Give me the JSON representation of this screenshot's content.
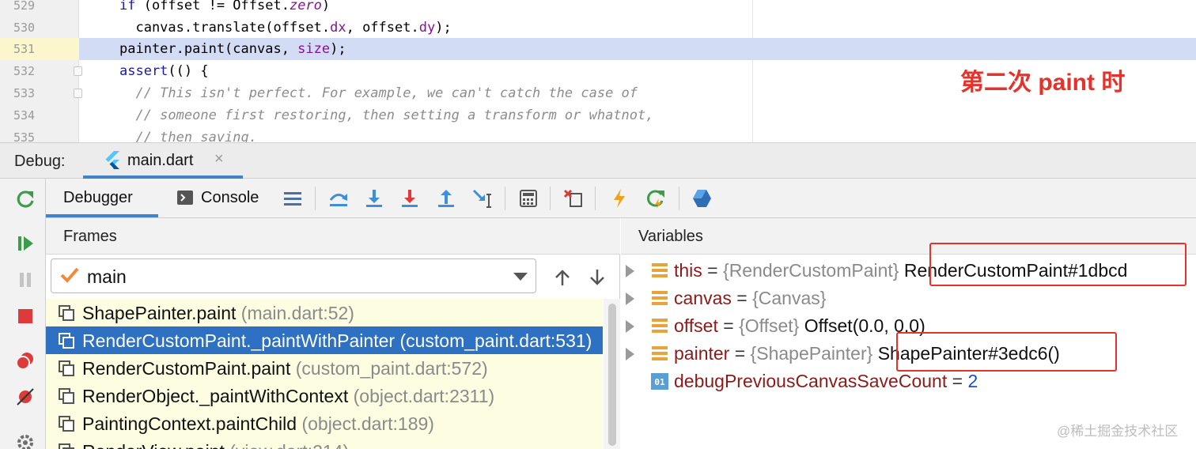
{
  "editor": {
    "lines": [
      {
        "num": "529",
        "code": "if (offset != Offset.zero)"
      },
      {
        "num": "530",
        "code": "  canvas.translate(offset.dx, offset.dy);"
      },
      {
        "num": "531",
        "code": "painter.paint(canvas, size);"
      },
      {
        "num": "532",
        "code": "assert(() {"
      },
      {
        "num": "533",
        "code": "  // This isn't perfect. For example, we can't catch the case of"
      },
      {
        "num": "534",
        "code": "  // someone first restoring, then setting a transform or whatnot,"
      },
      {
        "num": "535",
        "code": "  // then saving."
      }
    ],
    "annotation": "第二次 paint 时"
  },
  "debug": {
    "label": "Debug:",
    "tab": {
      "label": "main.dart",
      "close": "×"
    }
  },
  "toolbar": {
    "debugger_label": "Debugger",
    "console_label": "Console",
    "icons": [
      "layout-icon",
      "show-execution-point-icon",
      "step-over-icon",
      "step-into-icon",
      "force-step-into-icon",
      "step-out-icon",
      "run-to-cursor-icon",
      "evaluate-expression-icon",
      "drop-frame-icon",
      "hot-reload-icon",
      "hot-restart-icon",
      "dart-devtools-icon"
    ],
    "accent": "#4083c9"
  },
  "left_toolbar": {
    "icons": [
      "rerun-icon",
      "resume-icon",
      "pause-icon",
      "stop-icon",
      "view-breakpoints-icon",
      "mute-breakpoints-icon",
      "settings-icon"
    ]
  },
  "frames": {
    "title": "Frames",
    "thread": "main",
    "items": [
      {
        "method": "ShapePainter.paint",
        "location": "(main.dart:52)"
      },
      {
        "method": "RenderCustomPaint._paintWithPainter",
        "location": "(custom_paint.dart:531)"
      },
      {
        "method": "RenderCustomPaint.paint",
        "location": "(custom_paint.dart:572)"
      },
      {
        "method": "RenderObject._paintWithContext",
        "location": "(object.dart:2311)"
      },
      {
        "method": "PaintingContext.paintChild",
        "location": "(object.dart:189)"
      },
      {
        "method": "RenderView.paint",
        "location": "(view.dart:214)"
      }
    ],
    "selected_index": 1
  },
  "variables": {
    "title": "Variables",
    "items": [
      {
        "name": "this",
        "eq": " = ",
        "type": "{RenderCustomPaint}",
        "value": "RenderCustomPaint#1dbcd",
        "icon": "field-icon"
      },
      {
        "name": "canvas",
        "eq": " = ",
        "type": "{Canvas}",
        "value": "",
        "icon": "field-icon"
      },
      {
        "name": "offset",
        "eq": " = ",
        "type": "{Offset}",
        "value": "Offset(0.0, 0.0)",
        "icon": "field-icon"
      },
      {
        "name": "painter",
        "eq": " = ",
        "type": "{ShapePainter}",
        "value": "ShapePainter#3edc6()",
        "icon": "field-icon"
      },
      {
        "name": "debugPreviousCanvasSaveCount",
        "eq": " = ",
        "type": "",
        "value": "2",
        "icon": "primitive-01-icon"
      }
    ]
  },
  "watermark": "@稀土掘金技术社区",
  "colors": {
    "highlight_box": "#e6322a",
    "selection": "#2e70c2",
    "current_line": "#d2dcf4"
  }
}
